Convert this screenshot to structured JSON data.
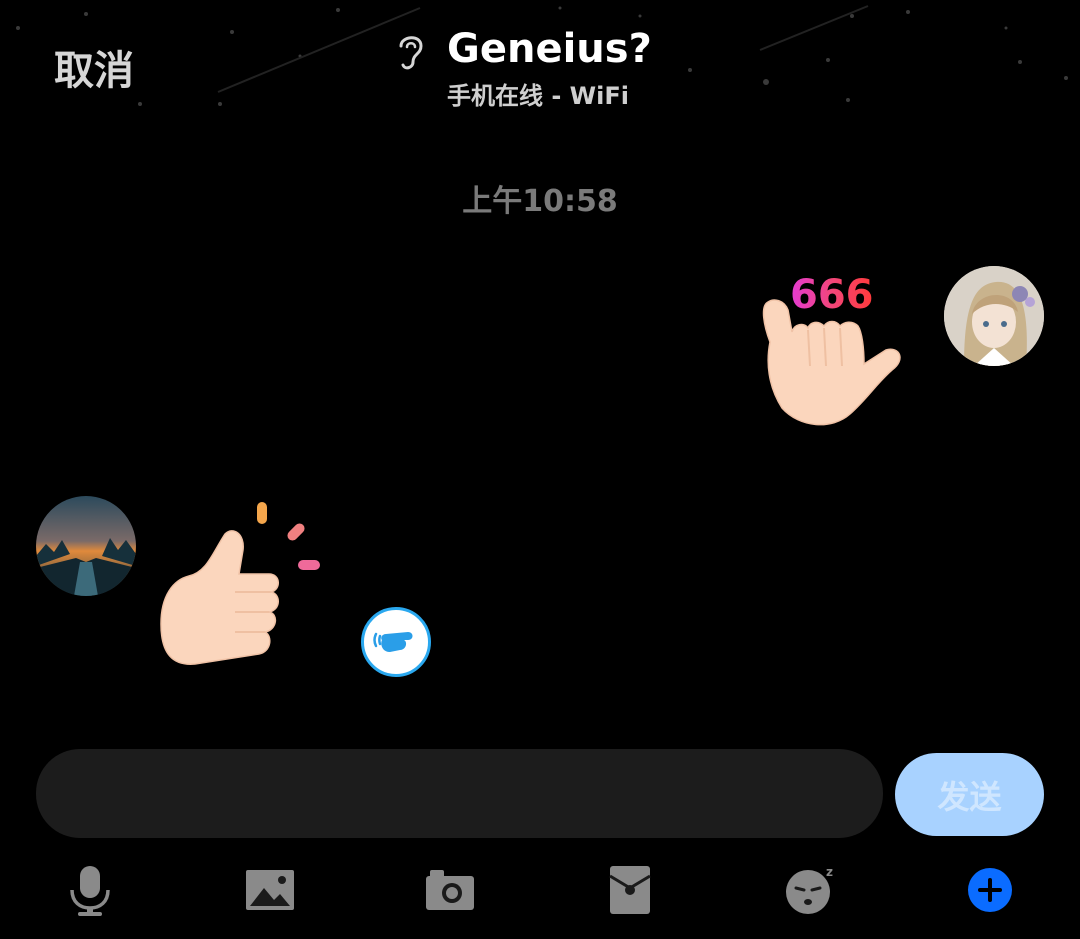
{
  "header": {
    "cancel_label": "取消",
    "contact_name": "Geneius?",
    "contact_status": "手机在线 - WiFi",
    "ear_icon": "ear-icon"
  },
  "chat": {
    "timestamp": "上午10:58",
    "messages": [
      {
        "sender": "me",
        "type": "sticker",
        "sticker_text": "666",
        "icon": "hang-loose-hand-icon"
      },
      {
        "sender": "other",
        "type": "sticker",
        "icon": "thumbs-up-icon",
        "poke_icon": "pointing-hand-icon"
      }
    ]
  },
  "composer": {
    "input_value": "",
    "send_label": "发送",
    "send_color": "#a8d2ff"
  },
  "toolbar": {
    "items": [
      {
        "icon": "microphone-icon"
      },
      {
        "icon": "image-icon"
      },
      {
        "icon": "camera-icon"
      },
      {
        "icon": "red-packet-icon"
      },
      {
        "icon": "emoji-icon"
      },
      {
        "icon": "plus-icon",
        "color": "#0a6cff"
      }
    ]
  }
}
